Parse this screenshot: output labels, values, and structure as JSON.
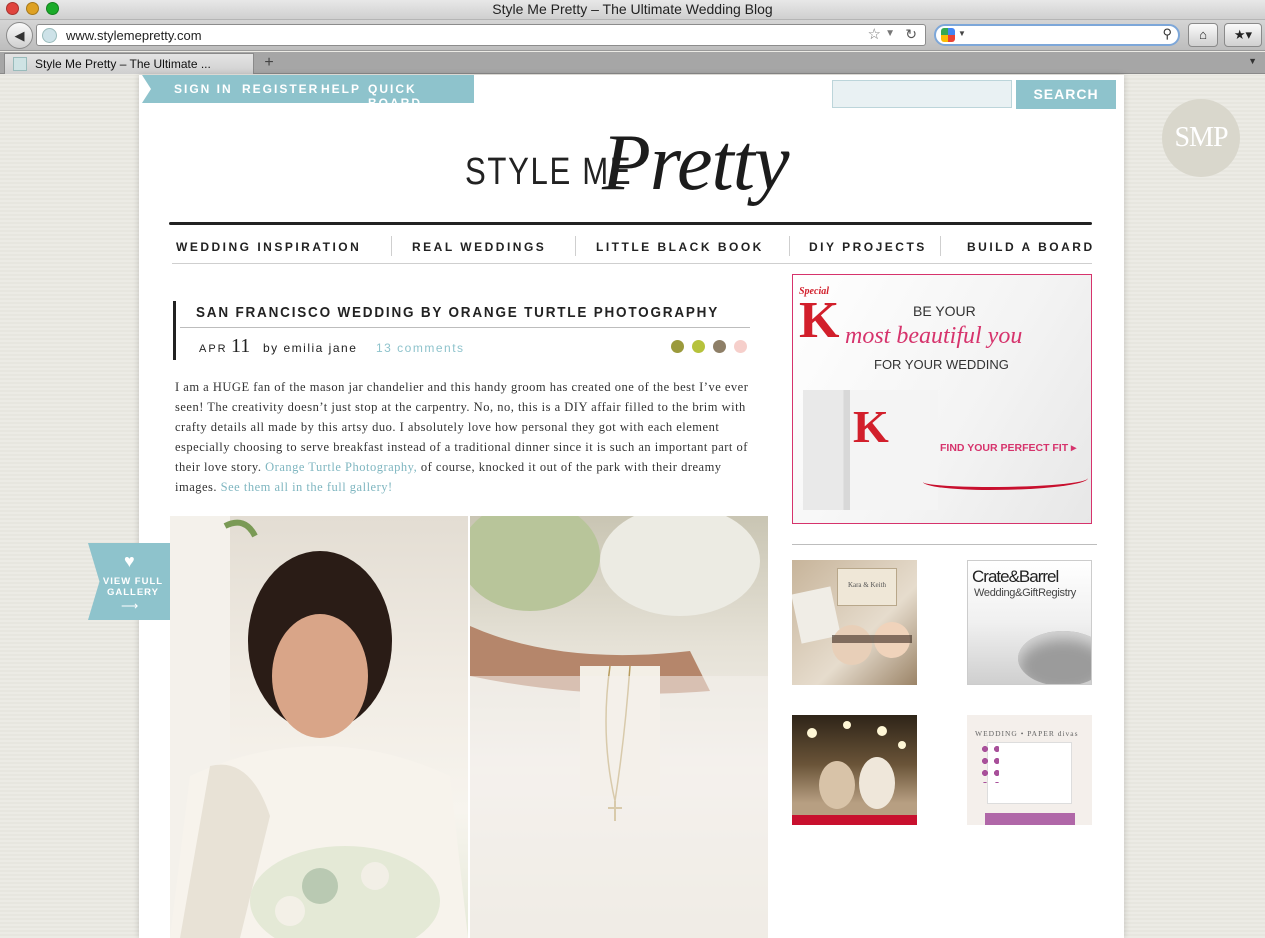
{
  "browser": {
    "window_title": "Style Me Pretty – The Ultimate Wedding Blog",
    "url": "www.stylemepretty.com",
    "tab_title": "Style Me Pretty – The Ultimate ...",
    "search_value": "",
    "icons": [
      "back-icon",
      "globe-icon",
      "star-icon",
      "reload-icon",
      "google-icon",
      "magnifier-icon",
      "home-icon",
      "bookmarks-icon"
    ]
  },
  "site": {
    "topnav": [
      "SIGN IN",
      "REGISTER",
      "HELP",
      "QUICK BOARD"
    ],
    "search_button": "SEARCH",
    "search_value": "",
    "badge": "SMP",
    "logo_plain": "STYLE ME",
    "logo_script": "Pretty",
    "mainnav": [
      "WEDDING INSPIRATION",
      "REAL WEDDINGS",
      "LITTLE BLACK BOOK",
      "DIY PROJECTS",
      "BUILD A BOARD"
    ],
    "accent_color": "#8ec3cc"
  },
  "post": {
    "title": "SAN FRANCISCO WEDDING BY ORANGE TURTLE PHOTOGRAPHY",
    "month": "APR",
    "day": "11",
    "author": "by emilia jane",
    "comments": "13 comments",
    "palette": [
      "#9b9a3c",
      "#b6c23c",
      "#8e7f67",
      "#f6cfcb"
    ],
    "body_1": "I am a HUGE fan of the mason jar chandelier and this handy groom has created one of the best I’ve ever seen!  The creativity doesn’t just stop at the carpentry.  No, no, this is a DIY affair filled to the brim with crafty details all made by this artsy duo.  I absolutely love how personal they got with each element especially choosing to serve breakfast instead of a traditional dinner since it is such an important part of their love story.  ",
    "link_1": "Orange Turtle Photography,",
    "body_2": " of course, knocked it out of the park with their dreamy images.  ",
    "link_2": "See them all in the full gallery!",
    "gallery_tab": "VIEW FULL GALLERY"
  },
  "sidebar": {
    "ad_main": {
      "brand_small": "Special",
      "brand_k": "K",
      "line1": "BE YOUR",
      "line2": "most beautiful you",
      "line3": "FOR YOUR WEDDING",
      "cta": "FIND YOUR PERFECT FIT ▸"
    },
    "ad_invites_card": "Kara & Keith",
    "ad_crate_1": "Crate&Barrel",
    "ad_crate_2": "Wedding&GiftRegistry",
    "ad_paper_title": "WEDDING • PAPER divas"
  }
}
